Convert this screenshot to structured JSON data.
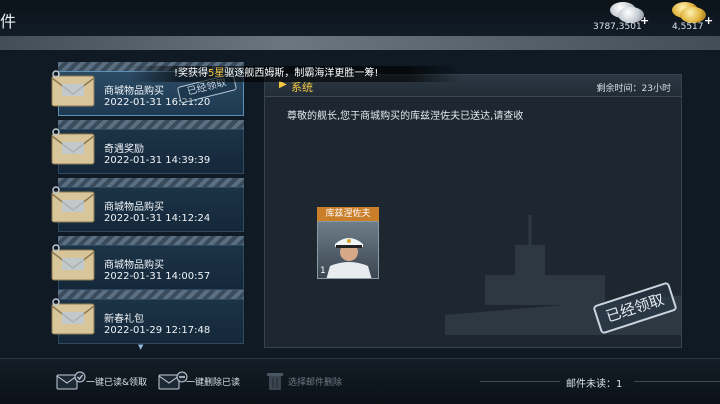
{
  "header": {
    "title": "件",
    "silver_value": "3787,3501",
    "gold_value": "4,5517"
  },
  "announcement": {
    "prefix": "!奖获得",
    "stars": "5星",
    "suffix": "驱逐舰西姆斯，制霸海洋更胜一筹!"
  },
  "mail_list": {
    "items": [
      {
        "title": "商城物品购买",
        "date": "2022-01-31 16:21:20",
        "stamp": "已经领取",
        "active": true
      },
      {
        "title": "奇遇奖励",
        "date": "2022-01-31 14:39:39",
        "stamp": "",
        "active": false
      },
      {
        "title": "商城物品购买",
        "date": "2022-01-31 14:12:24",
        "stamp": "",
        "active": false
      },
      {
        "title": "商城物品购买",
        "date": "2022-01-31 14:00:57",
        "stamp": "",
        "active": false
      },
      {
        "title": "新春礼包",
        "date": "2022-01-29 12:17:48",
        "stamp": "",
        "active": false
      }
    ]
  },
  "detail": {
    "sender": "系统",
    "remaining_label": "剩余时间：23小时",
    "body": "尊敬的舰长,您于商城购买的库兹涅佐夫已送达,请查收",
    "attachment": {
      "name": "库兹涅佐夫",
      "quantity": "1"
    },
    "claimed_stamp": "已经领取"
  },
  "footer": {
    "read_all_label": "一键已读&领取",
    "delete_read_label": "一键删除已读",
    "delete_selected_label": "选择邮件删除",
    "unread_label": "邮件未读：1"
  },
  "colors": {
    "accent_gold": "#f5c842",
    "attachment_tag": "#c97f2a",
    "panel_bg": "#1e2730"
  }
}
